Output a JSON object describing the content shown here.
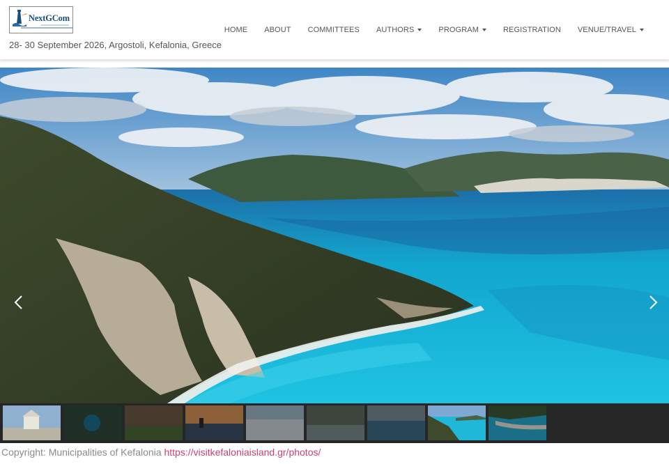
{
  "header": {
    "logo_text": "NextGCom",
    "event_date": "28- 30 September 2026, Argostoli, Kefalonia, Greece"
  },
  "nav": [
    {
      "label": "HOME",
      "dropdown": false
    },
    {
      "label": "ABOUT",
      "dropdown": false
    },
    {
      "label": "COMMITTEES",
      "dropdown": false
    },
    {
      "label": "AUTHORS",
      "dropdown": true
    },
    {
      "label": "PROGRAM",
      "dropdown": true
    },
    {
      "label": "REGISTRATION",
      "dropdown": false
    },
    {
      "label": "VENUE/TRAVEL",
      "dropdown": true
    }
  ],
  "carousel": {
    "prev_icon": "chevron-left-icon",
    "next_icon": "chevron-right-icon",
    "active_thumbnail": 7,
    "thumbnail_count": 9
  },
  "footer": {
    "copyright_text": "Copyright: Municipalities of Kefalonia",
    "copyright_link": "https://visitkefaloniaisland.gr/photos/"
  },
  "colors": {
    "link": "#c9426b",
    "sea": "#1fb8d8",
    "header_text": "#555555"
  }
}
